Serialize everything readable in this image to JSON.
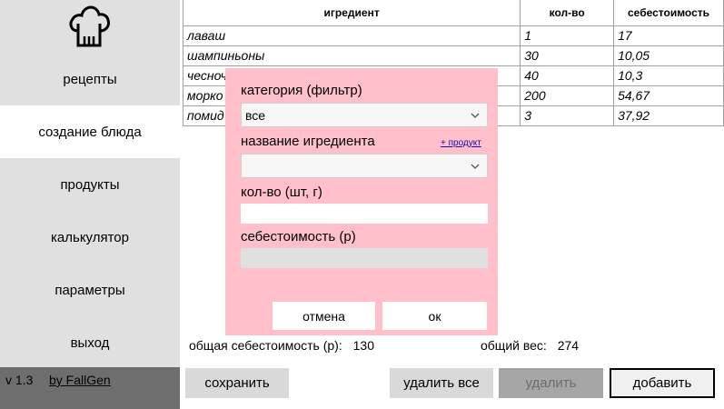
{
  "sidebar": {
    "logo_icon": "chef-hat-icon",
    "items": [
      {
        "label": "рецепты",
        "active": false
      },
      {
        "label": "создание блюда",
        "active": true
      },
      {
        "label": "продукты",
        "active": false
      },
      {
        "label": "калькулятор",
        "active": false
      },
      {
        "label": "параметры",
        "active": false
      },
      {
        "label": "выход",
        "active": false
      }
    ],
    "version": "v 1.3",
    "author": "by FallGen"
  },
  "table": {
    "headers": [
      "игредиент",
      "кол-во",
      "себестоимость"
    ],
    "rows": [
      [
        "лаваш",
        "1",
        "17"
      ],
      [
        "шампиньоны",
        "30",
        "10,05"
      ],
      [
        "чесноч",
        "40",
        "10,3"
      ],
      [
        "морко",
        "200",
        "54,67"
      ],
      [
        "помид",
        "3",
        "37,92"
      ]
    ]
  },
  "totals": {
    "cost_label": "общая себестоимость (р):",
    "cost_value": "130",
    "weight_label": "общий вес:",
    "weight_value": "274"
  },
  "buttons": {
    "save": "сохранить",
    "delete_all": "удалить все",
    "delete": "удалить",
    "add": "добавить"
  },
  "modal": {
    "category_label": "категория (фильтр)",
    "category_value": "все",
    "ingredient_label": "название игредиента",
    "add_product_link": "+ продукт",
    "ingredient_value": "",
    "qty_label": "кол-во (шт, г)",
    "qty_value": "",
    "cost_label": "себестоимость (р)",
    "cost_value": "",
    "cancel": "отмена",
    "ok": "ок"
  },
  "colors": {
    "sidebar_bg": "#e0e0e0",
    "sidebar_footer_bg": "#6e6e6e",
    "modal_bg": "#ffc0cb",
    "button_bg": "#d9d9d9",
    "button_disabled_bg": "#a6a6a6"
  }
}
